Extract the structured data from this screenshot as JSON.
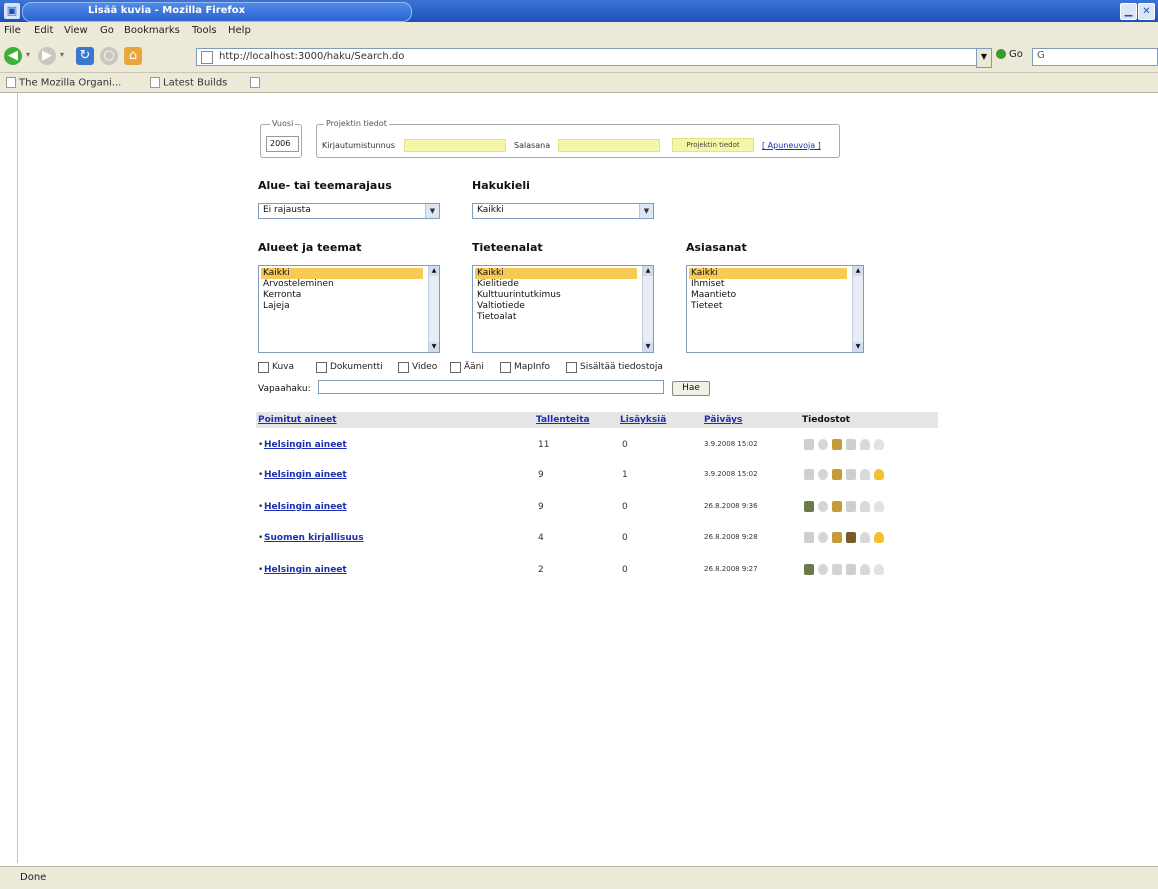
{
  "window": {
    "title": "Lisää kuvia - Mozilla Firefox"
  },
  "menu": [
    "File",
    "Edit",
    "View",
    "Go",
    "Bookmarks",
    "Tools",
    "Help"
  ],
  "nav": {
    "url": "http://localhost:3000/haku/Search.do",
    "go_label": "Go",
    "search_placeholder": "G"
  },
  "bookmarks": [
    "The Mozilla Organi...",
    "Latest Builds"
  ],
  "form": {
    "vuosi_legend": "Vuosi",
    "vuosi_value": "2006",
    "projekti_legend": "Projektin tiedot",
    "projekti_label": "Kirjautumistunnus",
    "salasana_label": "Salasana",
    "projekti_button": "Projektin tiedot",
    "help_link": "[ Apuneuvoja ]",
    "rajaus_header": "Alue- tai teemarajaus",
    "rajaus_value": "Ei rajausta",
    "kieli_header": "Hakukieli",
    "kieli_value": "Kaikki",
    "alueet_header": "Alueet ja teemat",
    "alueet_options": [
      "Kaikki",
      "Arvosteleminen",
      "Kerronta",
      "Lajeja"
    ],
    "tieteenalat_header": "Tieteenalat",
    "tieteenalat_options": [
      "Kaikki",
      "Kielitiede",
      "Kulttuurintutkimus",
      "Valtiotiede",
      "Tietoalat"
    ],
    "asiasanat_header": "Asiasanat",
    "asiasanat_options": [
      "Kaikki",
      "Ihmiset",
      "Maantieto",
      "Tieteet"
    ],
    "checkboxes": [
      "Kuva",
      "Dokumentti",
      "Video",
      "Ääni",
      "MapInfo",
      "Sisältää tiedostoja"
    ],
    "vapaa_label": "Vapaahaku:",
    "search_button": "Hae"
  },
  "table": {
    "headers": [
      "Poimitut aineet",
      "Tallenteita",
      "Lisäyksiä",
      "Päiväys",
      "Tiedostot"
    ],
    "rows": [
      {
        "name": "Helsingin aineet",
        "count": "11",
        "adds": "0",
        "date": "3.9.2008 15:02"
      },
      {
        "name": "Helsingin aineet",
        "count": "9",
        "adds": "1",
        "date": "3.9.2008 15:02"
      },
      {
        "name": "Helsingin aineet",
        "count": "9",
        "adds": "0",
        "date": "26.8.2008 9:36"
      },
      {
        "name": "Suomen kirjallisuus",
        "count": "4",
        "adds": "0",
        "date": "26.8.2008 9:28"
      },
      {
        "name": "Helsingin aineet",
        "count": "2",
        "adds": "0",
        "date": "26.8.2008 9:27"
      }
    ]
  },
  "status": {
    "text": "Done"
  }
}
